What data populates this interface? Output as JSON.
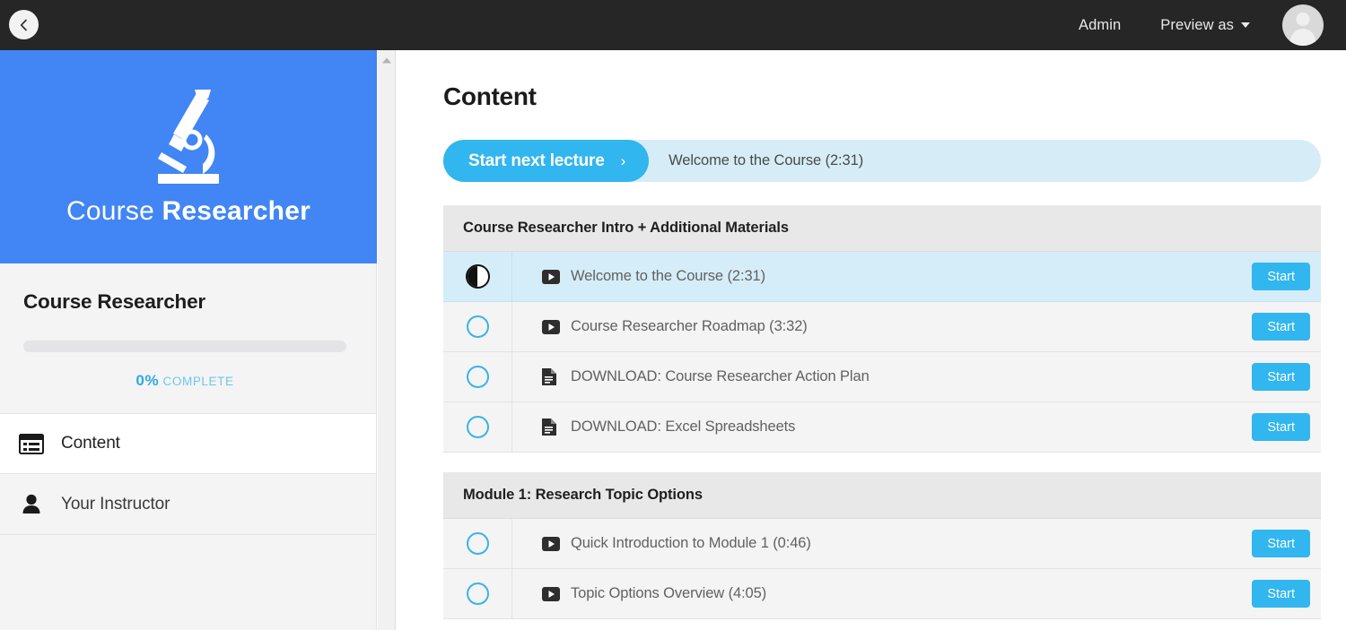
{
  "topbar": {
    "back_icon": "chevron-left-icon",
    "links": [
      {
        "label": "Admin",
        "caret": false
      },
      {
        "label": "Preview as",
        "caret": true
      }
    ],
    "avatar_icon": "user-avatar-icon"
  },
  "sidebar": {
    "logo": {
      "icon": "microscope-icon",
      "text_light": "Course ",
      "text_bold": "Researcher",
      "background": "#4285f4"
    },
    "course_title": "Course Researcher",
    "progress": {
      "percent": 0,
      "percent_label": "0%",
      "complete_label": "COMPLETE",
      "accent": "#2fa8e0"
    },
    "nav": [
      {
        "label": "Content",
        "icon": "content-list-icon",
        "active": true
      },
      {
        "label": "Your Instructor",
        "icon": "person-icon",
        "active": false
      }
    ]
  },
  "main": {
    "page_title": "Content",
    "cta": {
      "button_label": "Start next lecture",
      "chevron": "›",
      "next_lecture": "Welcome to the Course (2:31)",
      "button_color": "#31b6ef",
      "bar_color": "#d6edf7"
    },
    "start_label": "Start",
    "sections": [
      {
        "title": "Course Researcher Intro + Additional Materials",
        "lessons": [
          {
            "title": "Welcome to the Course (2:31)",
            "type": "video",
            "status": "in-progress",
            "current": true,
            "action": "Start"
          },
          {
            "title": "Course Researcher Roadmap (3:32)",
            "type": "video",
            "status": "not-started",
            "current": false,
            "action": "Start"
          },
          {
            "title": "DOWNLOAD: Course Researcher Action Plan",
            "type": "document",
            "status": "not-started",
            "current": false,
            "action": "Start"
          },
          {
            "title": "DOWNLOAD: Excel Spreadsheets",
            "type": "document",
            "status": "not-started",
            "current": false,
            "action": "Start"
          }
        ]
      },
      {
        "title": "Module 1: Research Topic Options",
        "lessons": [
          {
            "title": "Quick Introduction to Module 1 (0:46)",
            "type": "video",
            "status": "not-started",
            "current": false,
            "action": "Start"
          },
          {
            "title": "Topic Options Overview (4:05)",
            "type": "video",
            "status": "not-started",
            "current": false,
            "action": "Start"
          }
        ]
      }
    ]
  }
}
